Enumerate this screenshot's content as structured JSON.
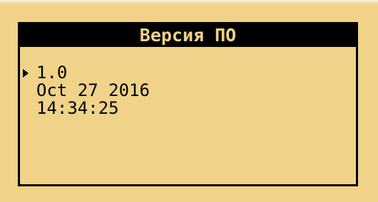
{
  "screen": {
    "title": "Версия ПО",
    "selected_index": 0,
    "lines": [
      "1.0",
      "Oct 27 2016",
      "14:34:25"
    ]
  },
  "colors": {
    "background": "#f0d288",
    "title_bar": "#000000",
    "text": "#000000"
  },
  "icons": {
    "cursor": "selection-arrow-icon"
  }
}
